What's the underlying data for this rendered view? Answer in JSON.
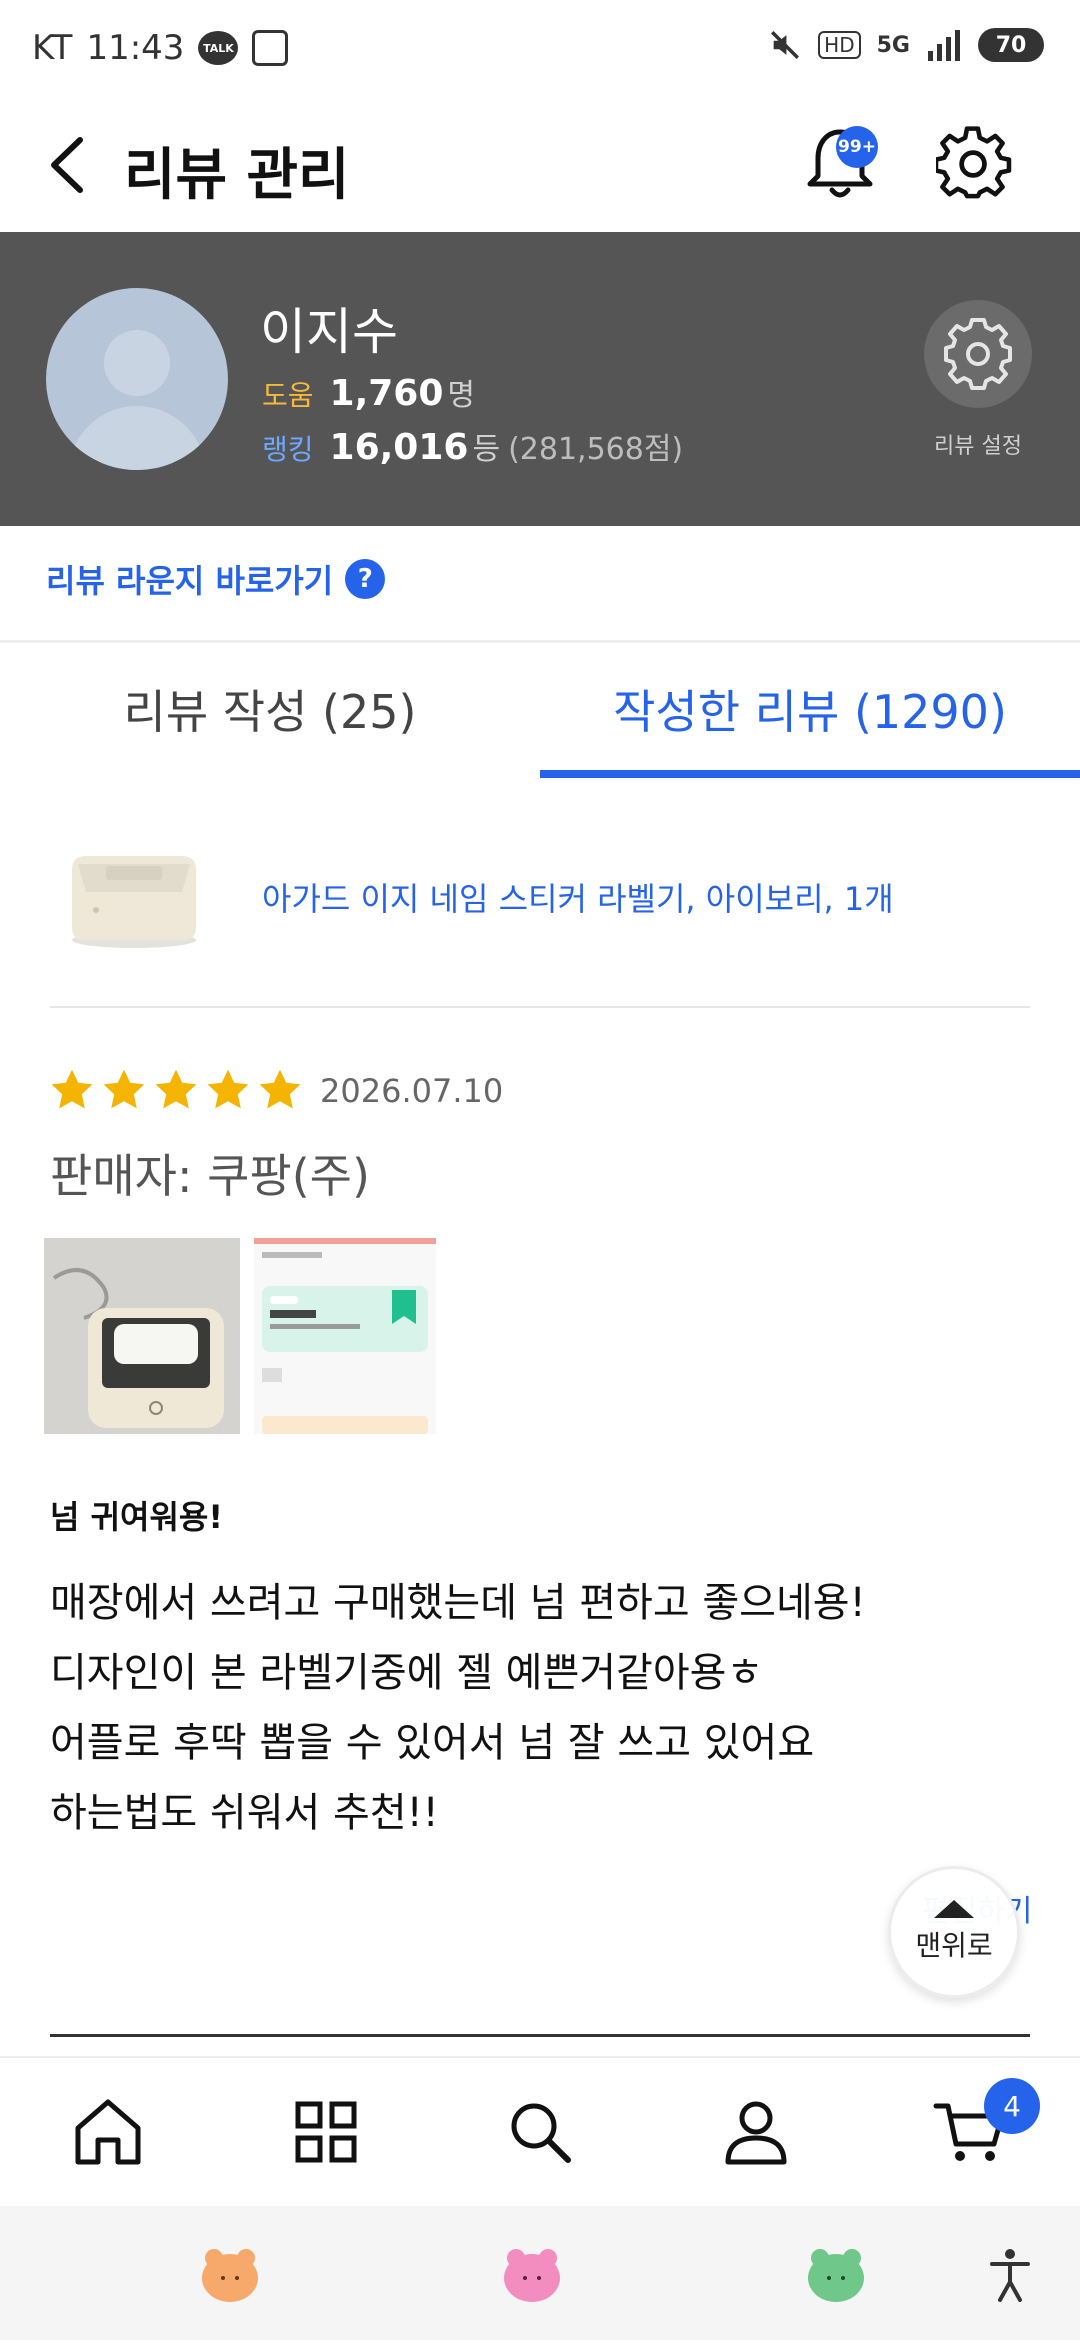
{
  "status_bar": {
    "carrier": "KT",
    "time": "11:43",
    "talk_icon_text": "TALK",
    "hd_text": "HD",
    "network_text": "5G",
    "battery": "70"
  },
  "header": {
    "title": "리뷰 관리",
    "notification_badge": "99+"
  },
  "profile": {
    "name": "이지수",
    "help_label": "도움",
    "help_value": "1,760",
    "help_unit": "명",
    "rank_label": "랭킹",
    "rank_value": "16,016",
    "rank_unit": "등",
    "rank_points": "(281,568점)",
    "setting_label": "리뷰 설정"
  },
  "lounge": {
    "label": "리뷰 라운지 바로가기",
    "help_glyph": "?"
  },
  "tabs": [
    {
      "label": "리뷰 작성 (25)",
      "active": false
    },
    {
      "label": "작성한 리뷰 (1290)",
      "active": true
    }
  ],
  "product": {
    "name": "아가드 이지 네임 스티커 라벨기, 아이보리, 1개"
  },
  "review": {
    "rating": 5,
    "date": "2026.07.10",
    "seller": "판매자: 쿠팡(주)",
    "title": "넘 귀여워용!",
    "body_lines": [
      "매장에서 쓰려고 구매했는데 넘 편하고 좋으네용!",
      "디자인이 본 라벨기중에 젤 예쁜거같아용ㅎ",
      "어플로 후딱 뽑을 수 있어서 넘 잘 쓰고 있어요",
      "하는법도 쉬워서 추천!!"
    ],
    "edit_label": "편집하기"
  },
  "scroll_top": {
    "label": "맨위로"
  },
  "bottom_nav": {
    "cart_count": "4"
  },
  "colors": {
    "accent": "#2563eb",
    "profile_bg": "#555555",
    "star": "#f5b400",
    "help_label": "#f6b93b",
    "rank_label": "#6ea8ff"
  }
}
